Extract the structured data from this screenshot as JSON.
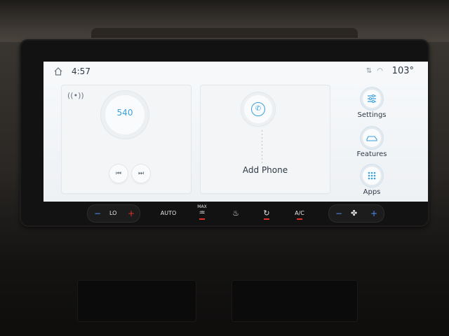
{
  "status": {
    "time": "4:57",
    "temperature": "103°"
  },
  "radio": {
    "frequency": "540"
  },
  "phone": {
    "label": "Add Phone"
  },
  "side_menu": [
    {
      "label": "Settings"
    },
    {
      "label": "Features"
    },
    {
      "label": "Apps"
    }
  ],
  "hvac": {
    "minus": "−",
    "temp_left": "LO",
    "plus": "+",
    "auto": "AUTO",
    "max_defrost": "MAX",
    "ac": "A/C"
  },
  "colors": {
    "accent": "#3aa0dc",
    "indicator": "#e0312c"
  }
}
